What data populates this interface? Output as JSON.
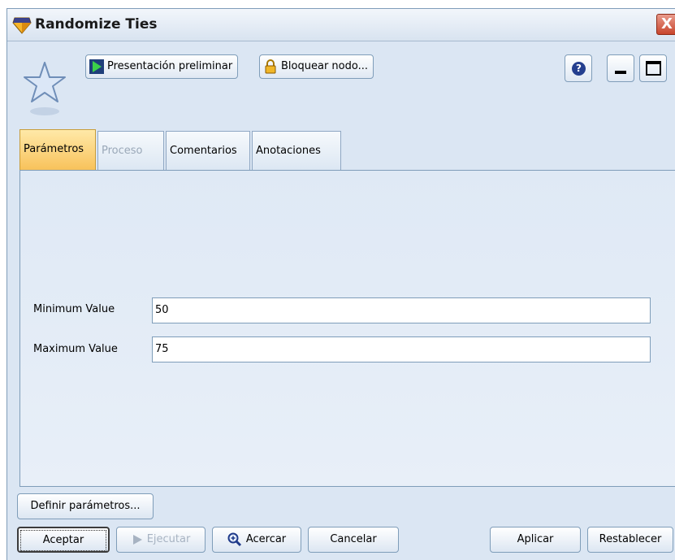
{
  "window": {
    "title": "Randomize Ties",
    "close_glyph": "X"
  },
  "toolbar": {
    "preview_label": "Presentación preliminar",
    "lock_label": "Bloquear nodo...",
    "help_glyph": "?"
  },
  "tabs": [
    {
      "label": "Parámetros",
      "state": "active"
    },
    {
      "label": "Proceso",
      "state": "disabled"
    },
    {
      "label": "Comentarios",
      "state": "normal"
    },
    {
      "label": "Anotaciones",
      "state": "normal"
    }
  ],
  "form": {
    "min_label": "Minimum Value",
    "min_value": "50",
    "max_label": "Maximum Value",
    "max_value": "75"
  },
  "buttons": {
    "define_params": "Definir parámetros...",
    "ok": "Aceptar",
    "run": "Ejecutar",
    "zoom": "Acercar",
    "cancel": "Cancelar",
    "apply": "Aplicar",
    "reset": "Restablecer"
  },
  "icons": {
    "title": "node-diamond-icon",
    "star": "star-icon",
    "preview": "play-green-icon",
    "lock": "padlock-icon",
    "zoom": "magnifier-icon"
  },
  "colors": {
    "accent_tab": "#f8c25b",
    "close": "#c8452c",
    "panel": "#dfe9f5"
  }
}
